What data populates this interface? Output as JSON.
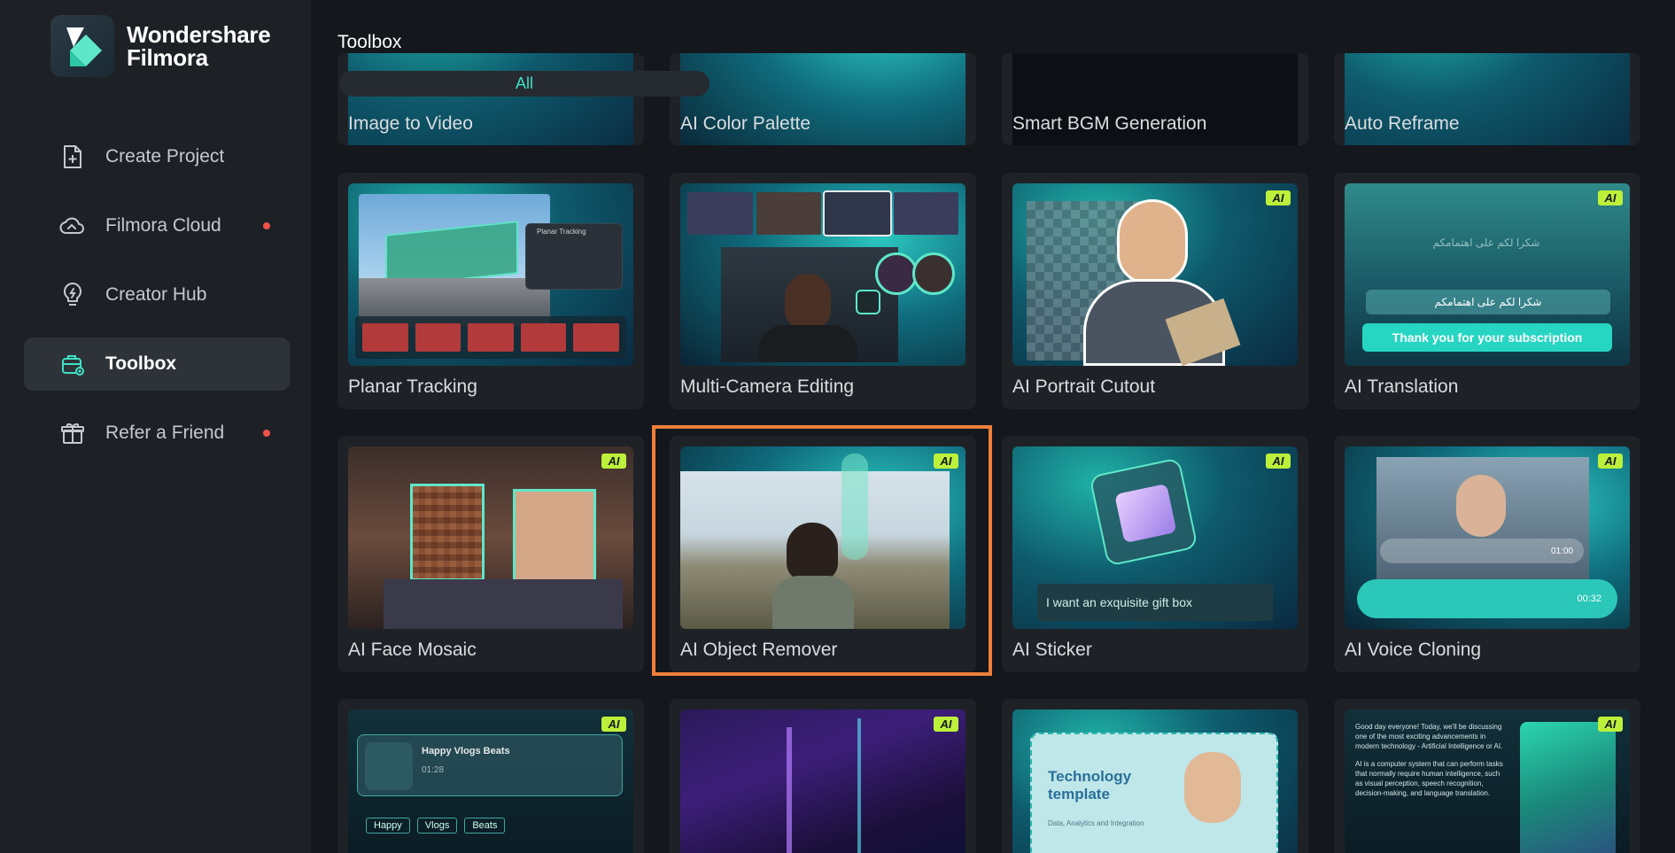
{
  "app": {
    "brand_line1": "Wondershare",
    "brand_line2": "Filmora"
  },
  "sidebar": {
    "items": [
      {
        "label": "Create Project",
        "icon": "plus-document-icon",
        "active": false,
        "dot": false
      },
      {
        "label": "Filmora Cloud",
        "icon": "cloud-icon",
        "active": false,
        "dot": true
      },
      {
        "label": "Creator Hub",
        "icon": "lightbulb-icon",
        "active": false,
        "dot": false
      },
      {
        "label": "Toolbox",
        "icon": "toolbox-icon",
        "active": true,
        "dot": false
      },
      {
        "label": "Refer a Friend",
        "icon": "gift-icon",
        "active": false,
        "dot": true
      }
    ]
  },
  "main": {
    "title": "Toolbox",
    "filter_label": "All",
    "ai_badge": "AI",
    "row0": [
      "Image to Video",
      "AI Color Palette",
      "Smart BGM Generation",
      "Auto Reframe"
    ],
    "row1": [
      "Planar Tracking",
      "Multi-Camera Editing",
      "AI Portrait Cutout",
      "AI Translation"
    ],
    "row2": [
      "AI Face Mosaic",
      "AI Object Remover",
      "AI Sticker",
      "AI Voice Cloning"
    ],
    "thumb_text": {
      "planar_panel": "Planar Tracking",
      "translation_arabic_1": "شكرا لكم على اهتمامكم",
      "translation_arabic_2": "شكرا لكم على اهتمامكم",
      "translation_english": "Thank you for your subscription",
      "sticker_prompt": "I want an exquisite gift box",
      "voice_time_1": "01:00",
      "voice_time_2": "00:32",
      "music_title": "Happy Vlogs Beats",
      "music_time": "01:28",
      "music_tags": [
        "Happy",
        "Vlogs",
        "Beats"
      ],
      "template_title": "Technology template",
      "template_sub": "Data, Analytics and Integration",
      "article_text": "Good day everyone! Today, we'll be discussing one of the most exciting advancements in modern technology - Artificial Intelligence or AI.",
      "article_text_2": "AI is a computer system that can perform tasks that normally require human intelligence, such as visual perception, speech recognition, decision-making, and language translation."
    }
  }
}
